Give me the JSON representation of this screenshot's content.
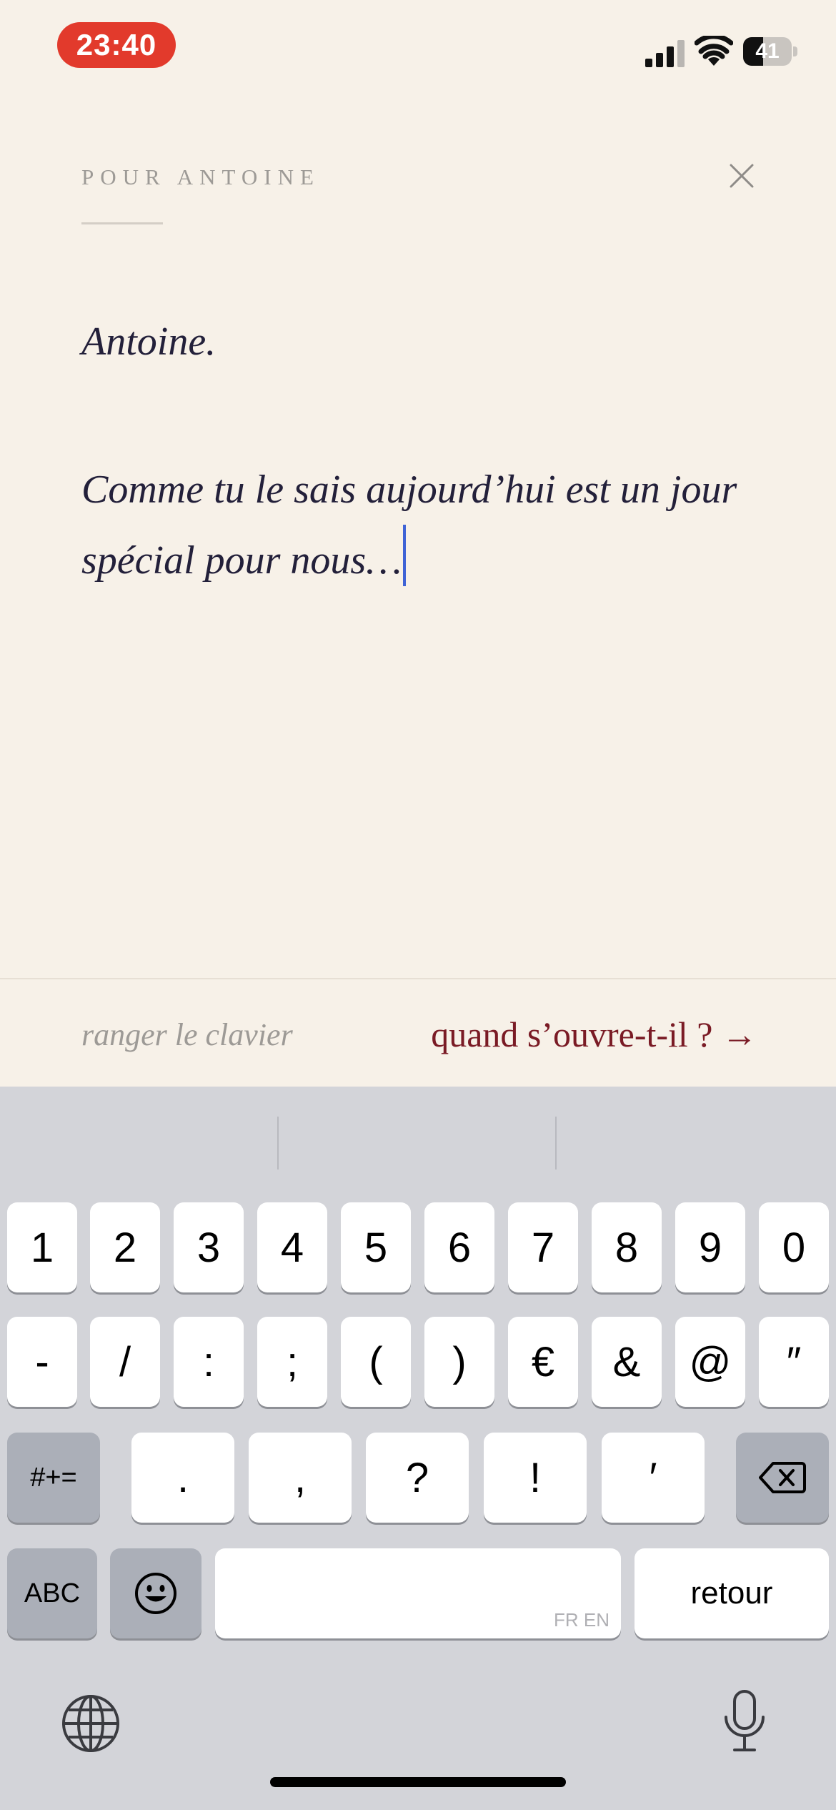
{
  "status_bar": {
    "time": "23:40",
    "battery_level": "41",
    "battery_fraction": 0.41,
    "icons": [
      "signal-icon",
      "wifi-icon",
      "battery-icon"
    ]
  },
  "header": {
    "recipient_label": "POUR ANTOINE",
    "close_icon": "close-icon"
  },
  "letter": {
    "greeting": "Antoine.",
    "message": "Comme tu le sais aujourd’hui est un jour spécial pour nous…"
  },
  "actions": {
    "hide_keyboard": "ranger le clavier",
    "schedule": "quand s’ouvre-t-il ? →",
    "accent_color": "#7a1b25"
  },
  "keyboard": {
    "row1": [
      "1",
      "2",
      "3",
      "4",
      "5",
      "6",
      "7",
      "8",
      "9",
      "0"
    ],
    "row2": [
      "-",
      "/",
      ":",
      ";",
      "(",
      ")",
      "€",
      "&",
      "@",
      "″"
    ],
    "row3": {
      "symbols": "#+=",
      "keys": [
        ".",
        ",",
        "?",
        "!",
        "′"
      ],
      "delete_icon": "backspace-icon"
    },
    "row4": {
      "abc": "ABC",
      "emoji_icon": "emoji-icon",
      "space_language": "FR EN",
      "return": "retour"
    },
    "bottom": {
      "globe_icon": "globe-icon",
      "mic_icon": "microphone-icon"
    }
  }
}
